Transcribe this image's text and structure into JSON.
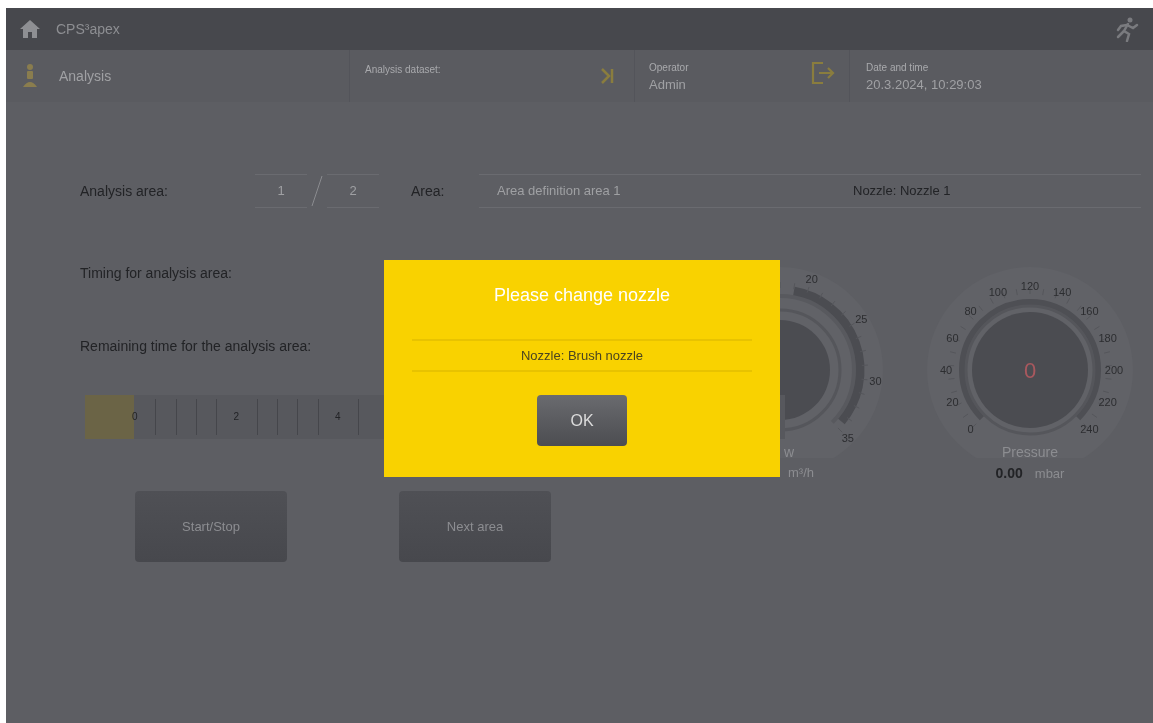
{
  "title_bar": {
    "title": "CPS³apex"
  },
  "header": {
    "page": "Analysis",
    "dataset_label": "Analysis dataset:",
    "operator_label": "Operator",
    "operator": "Admin",
    "datetime_label": "Date and time",
    "datetime": "20.3.2024, 10:29:03"
  },
  "area_row": {
    "label": "Analysis area:",
    "current": "1",
    "total": "2",
    "area_label": "Area:",
    "area": "Area definition area 1",
    "nozzle": "Nozzle: Nozzle 1"
  },
  "timing_label": "Timing for analysis area:",
  "remaining_label": "Remaining time for the analysis area:",
  "timeline": {
    "level": 0.07,
    "ticks": [
      "0",
      "2",
      "4"
    ]
  },
  "buttons": [
    "Start/Stop",
    "Next area"
  ],
  "gauges": [
    {
      "kind": "flow",
      "labels": [
        "20",
        "25",
        "30",
        "35"
      ],
      "label": "w",
      "unit": "m³/h"
    },
    {
      "kind": "pressure",
      "labels": [
        "0",
        "20",
        "40",
        "60",
        "80",
        "100",
        "120",
        "140",
        "160",
        "180",
        "200",
        "220",
        "240"
      ],
      "label": "Pressure",
      "reading": "0.00",
      "unit": "mbar",
      "value": "0"
    }
  ],
  "dialog": {
    "title": "Please change nozzle",
    "message": "Nozzle: Brush nozzle",
    "button": "OK"
  }
}
